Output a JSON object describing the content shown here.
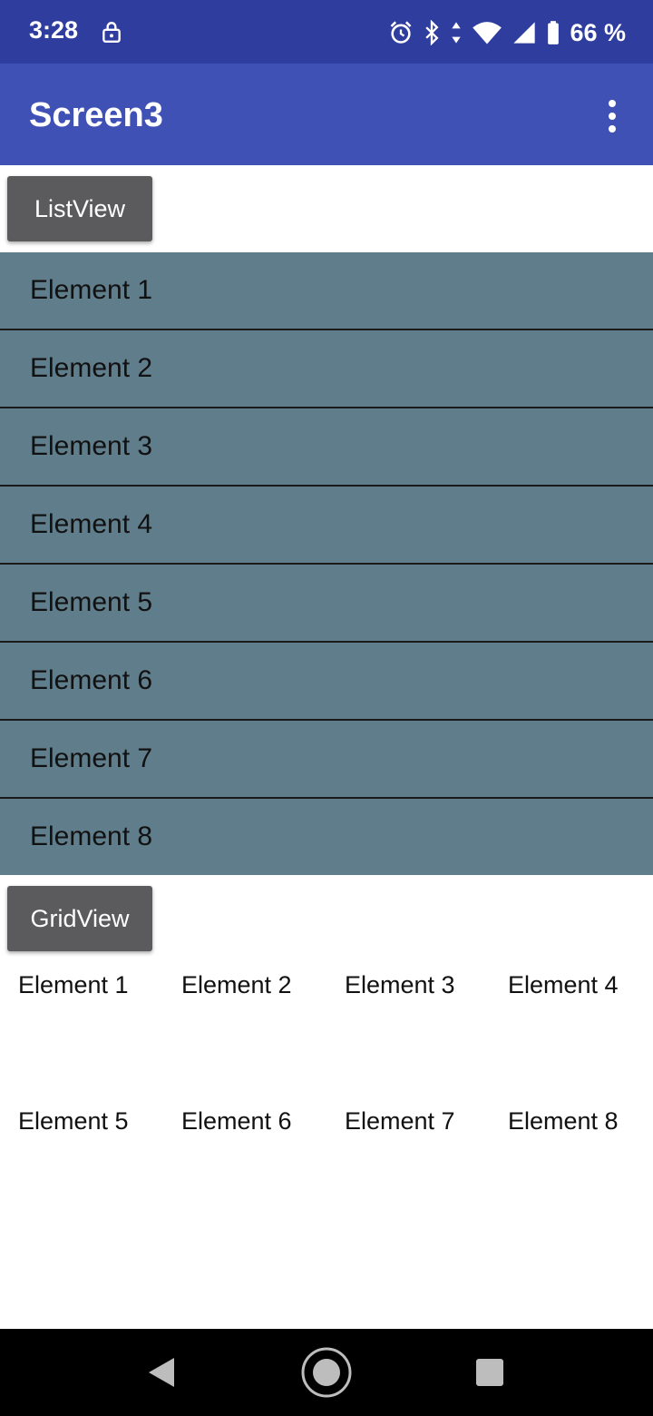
{
  "status_bar": {
    "time": "3:28",
    "battery": "66 %",
    "icons": [
      "lock-icon",
      "alarm-icon",
      "bluetooth-icon",
      "data-arrows-icon",
      "wifi-icon",
      "signal-icon",
      "battery-icon"
    ]
  },
  "app_bar": {
    "title": "Screen3",
    "menu_icon": "more-vert-icon"
  },
  "list_section": {
    "button_label": "ListView",
    "items": [
      "Element 1",
      "Element 2",
      "Element 3",
      "Element 4",
      "Element 5",
      "Element 6",
      "Element 7",
      "Element 8"
    ]
  },
  "grid_section": {
    "button_label": "GridView",
    "items": [
      "Element 1",
      "Element 2",
      "Element 3",
      "Element 4",
      "Element 5",
      "Element 6",
      "Element 7",
      "Element 8"
    ]
  },
  "nav_bar": {
    "icons": [
      "back-icon",
      "home-icon",
      "recents-icon"
    ]
  },
  "colors": {
    "status_bar": "#2f3d9e",
    "app_bar": "#3f51b5",
    "list_bg": "#607d8b",
    "button_bg": "#5b5b5d"
  }
}
